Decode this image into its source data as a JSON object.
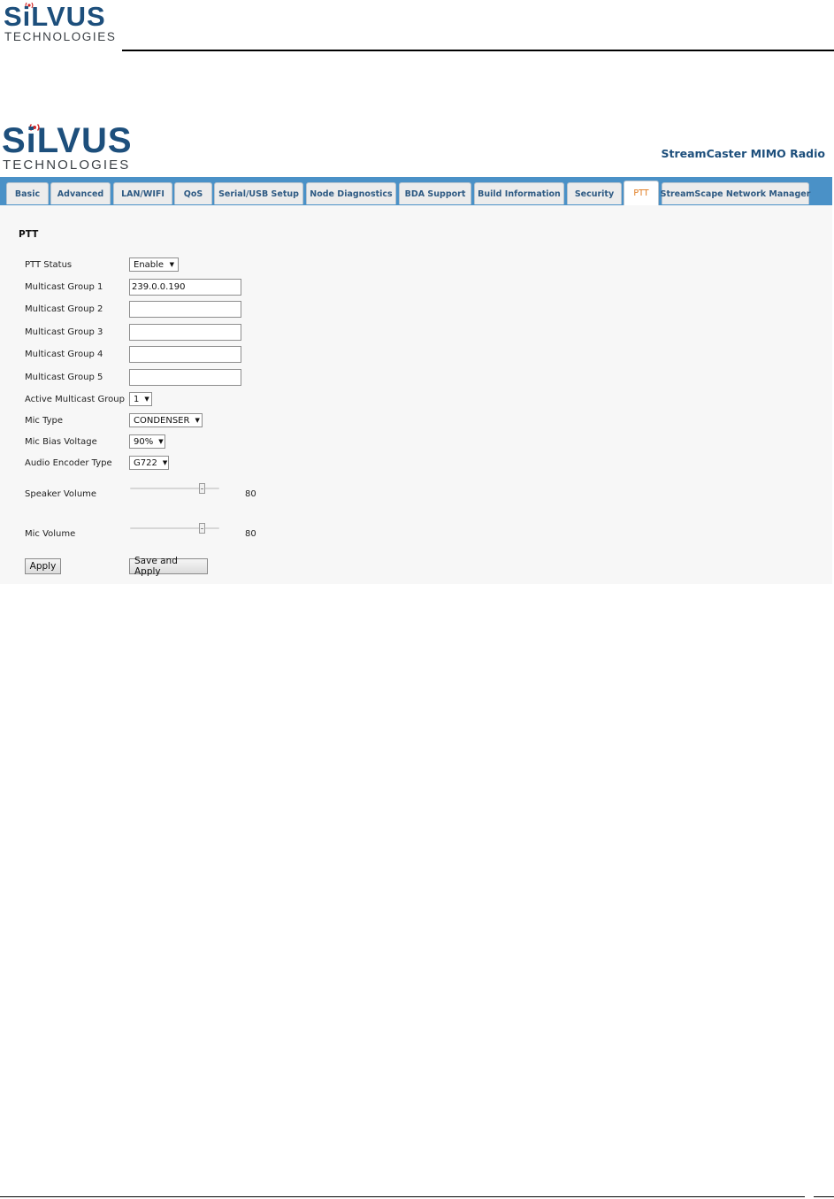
{
  "document": {
    "logo_brand": "SiLVUS",
    "logo_sub": "TECHNOLOGIES"
  },
  "app": {
    "logo_brand": "SiLVUS",
    "logo_sub": "TECHNOLOGIES",
    "product_name": "StreamCaster MIMO Radio",
    "tabs": [
      {
        "label": "Basic"
      },
      {
        "label": "Advanced"
      },
      {
        "label": "LAN/WIFI"
      },
      {
        "label": "QoS"
      },
      {
        "label": "Serial/USB Setup"
      },
      {
        "label": "Node Diagnostics"
      },
      {
        "label": "BDA Support"
      },
      {
        "label": "Build Information"
      },
      {
        "label": "Security"
      },
      {
        "label": "PTT"
      },
      {
        "label": "StreamScape Network Manager"
      }
    ],
    "active_tab": "PTT",
    "colors": {
      "brand": "#1d4f7c",
      "tabbar": "#4a91c7",
      "active_tab_text": "#e07b1f"
    },
    "ptt": {
      "title": "PTT",
      "ptt_status": {
        "label": "PTT Status",
        "value": "Enable"
      },
      "multicast_groups": [
        {
          "label": "Multicast Group 1",
          "value": "239.0.0.190"
        },
        {
          "label": "Multicast Group 2",
          "value": ""
        },
        {
          "label": "Multicast Group 3",
          "value": ""
        },
        {
          "label": "Multicast Group 4",
          "value": ""
        },
        {
          "label": "Multicast Group 5",
          "value": ""
        }
      ],
      "active_multicast_group": {
        "label": "Active Multicast Group",
        "value": "1"
      },
      "mic_type": {
        "label": "Mic Type",
        "value": "CONDENSER"
      },
      "mic_bias_voltage": {
        "label": "Mic Bias Voltage",
        "value": "90%"
      },
      "audio_encoder_type": {
        "label": "Audio Encoder Type",
        "value": "G722"
      },
      "speaker_volume": {
        "label": "Speaker Volume",
        "value": "80",
        "fraction": 0.8
      },
      "mic_volume": {
        "label": "Mic Volume",
        "value": "80",
        "fraction": 0.8
      },
      "apply_label": "Apply",
      "save_apply_label": "Save and Apply"
    }
  }
}
